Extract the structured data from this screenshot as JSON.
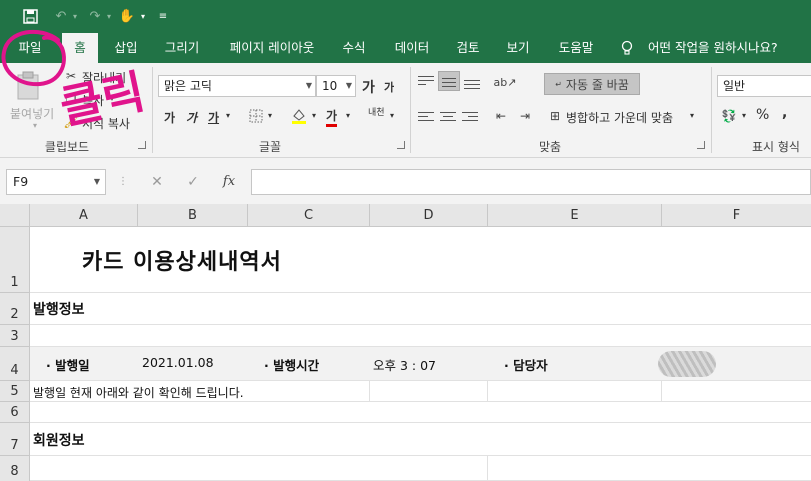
{
  "qat": {
    "save_icon": "save-icon",
    "undo_icon": "undo-icon",
    "redo_icon": "redo-icon",
    "touch_icon": "touch-mode-icon"
  },
  "tabs": [
    {
      "label": "파일"
    },
    {
      "label": "홈"
    },
    {
      "label": "삽입"
    },
    {
      "label": "그리기"
    },
    {
      "label": "페이지 레이아웃"
    },
    {
      "label": "수식"
    },
    {
      "label": "데이터"
    },
    {
      "label": "검토"
    },
    {
      "label": "보기"
    },
    {
      "label": "도움말"
    }
  ],
  "tell_me": "어떤 작업을 원하시나요?",
  "clipboard": {
    "paste": "붙여넣기",
    "cut": "잘라내기",
    "copy": "복사",
    "format_painter": "서식 복사",
    "group": "클립보드"
  },
  "font": {
    "name": "맑은 고딕",
    "size": "10",
    "grow": "가",
    "shrink": "가",
    "bold": "가",
    "italic": "가",
    "underline": "가",
    "font_color": "가",
    "phonetic": "내천",
    "group": "글꼴"
  },
  "alignment": {
    "wrap_text": "자동 줄 바꿈",
    "merge_center": "병합하고 가운데 맞춤",
    "group": "맞춤"
  },
  "number": {
    "format": "일반",
    "percent": "%",
    "comma": ",",
    "group": "표시 형식"
  },
  "formula_bar": {
    "name_box": "F9",
    "formula": ""
  },
  "columns": [
    "A",
    "B",
    "C",
    "D",
    "E",
    "F"
  ],
  "rows": [
    "1",
    "2",
    "3",
    "4",
    "5",
    "6",
    "7",
    "8"
  ],
  "cells": {
    "title": "카드 이용상세내역서",
    "issue_info": "발행정보",
    "issue_date_label": "· 발행일",
    "issue_date": "2021.01.08",
    "issue_time_label": "· 발행시간",
    "issue_time": "오후 3 : 07",
    "manager_label": "· 담당자",
    "notice": "발행일 현재 아래와 같이 확인해 드립니다.",
    "member_info": "회원정보"
  },
  "annotation": {
    "text": "클릭",
    "color": "#e0148c"
  },
  "colors": {
    "excel_green": "#217346",
    "ribbon": "#f3f3f3",
    "annotation": "#e0148c"
  }
}
